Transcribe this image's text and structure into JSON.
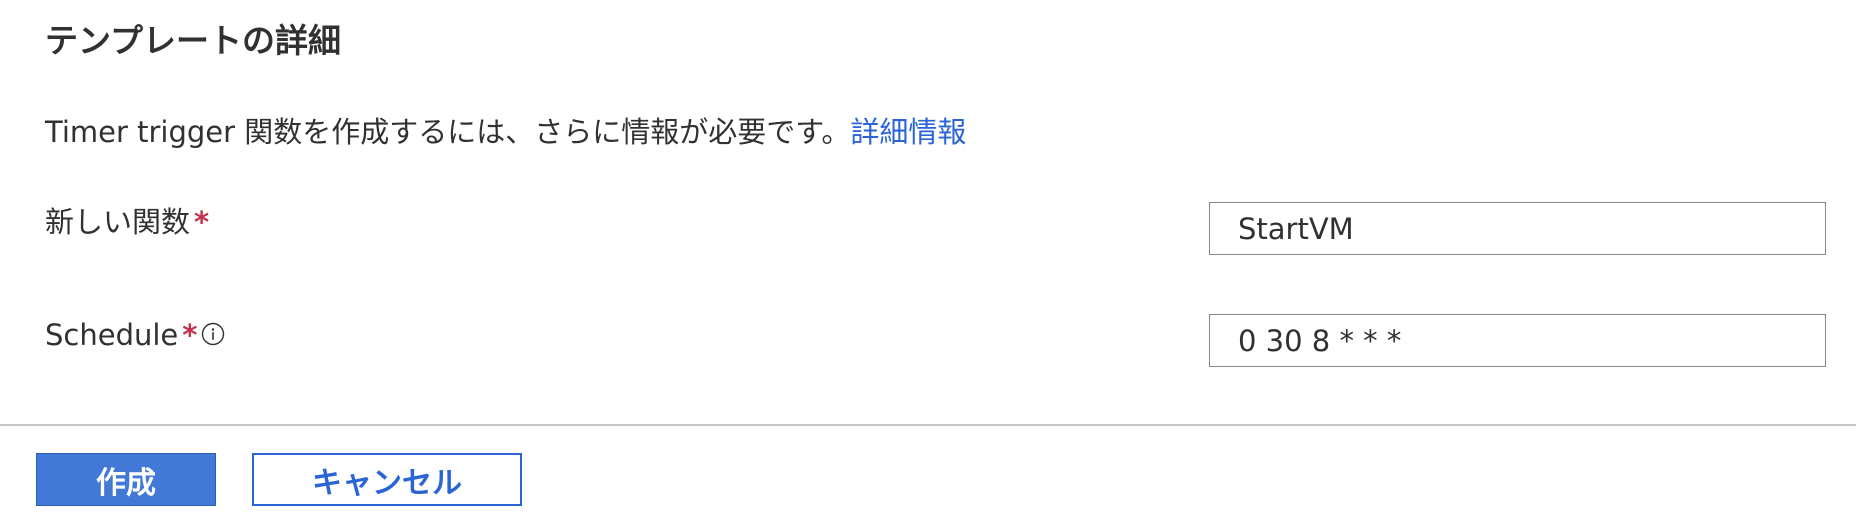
{
  "dialog": {
    "title": "テンプレートの詳細",
    "description": "Timer trigger 関数を作成するには、さらに情報が必要です。",
    "learn_more_link": "詳細情報"
  },
  "fields": {
    "function_name": {
      "label": "新しい関数",
      "required_marker": "*",
      "value": "StartVM"
    },
    "schedule": {
      "label": "Schedule",
      "required_marker": "*",
      "info_icon": "info-icon",
      "value": "0 30 8 * * *"
    }
  },
  "footer": {
    "create_label": "作成",
    "cancel_label": "キャンセル"
  },
  "colors": {
    "accent": "#2a64d6",
    "primary_button": "#4279d6",
    "required": "#c4314b",
    "text": "#323130",
    "divider": "#c8c6c4"
  }
}
